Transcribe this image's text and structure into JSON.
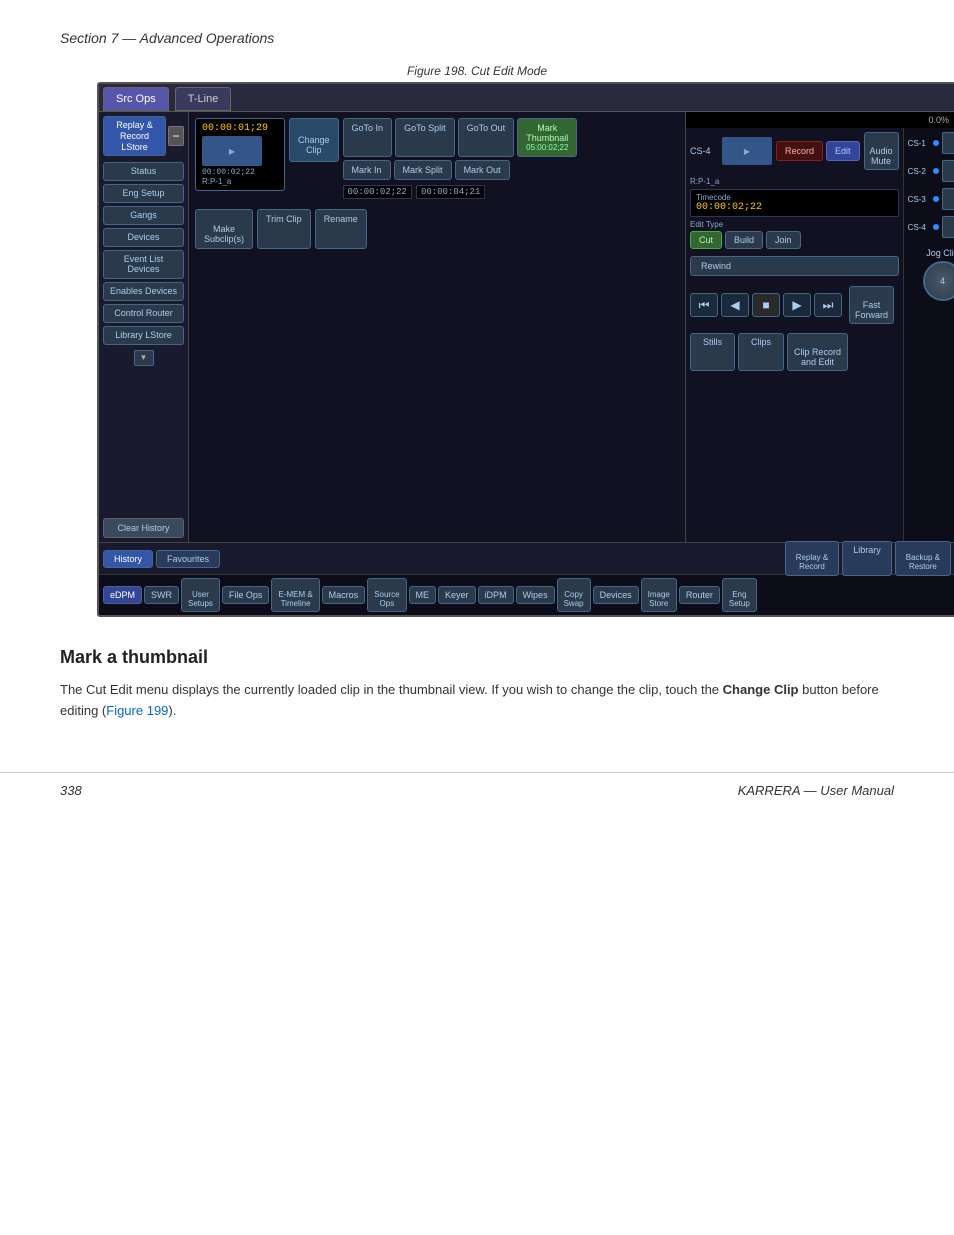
{
  "header": {
    "text": "Section 7 — Advanced Operations"
  },
  "figure": {
    "caption": "Figure 198.  Cut Edit Mode"
  },
  "tabs": {
    "src_ops": "Src Ops",
    "t_line": "T-Line"
  },
  "sidebar": {
    "replay_record": "Replay &\nRecord\nLStore",
    "status": "Status",
    "eng_setup": "Eng Setup",
    "gangs": "Gangs",
    "devices": "Devices",
    "event_list": "Event List\nDevices",
    "enables": "Enables\nDevices",
    "control": "Control\nRouter",
    "library": "Library\nLStore",
    "clear_history": "Clear History",
    "history": "History",
    "favourites": "Favourites"
  },
  "center": {
    "timecode1": "00:00:01;29",
    "timecode2": "00:00:02;22",
    "timecode3": "00:00:04;21",
    "rp1a": "R:P-1_a",
    "change_clip": "Change\nClip",
    "goto_in": "GoTo In",
    "goto_split": "GoTo Split",
    "goto_out": "GoTo Out",
    "mark_thumbnail": "Mark\nThumbnail",
    "mark_thumbnail_tc": "05:00:02;22",
    "mark_in": "Mark In",
    "mark_split": "Mark Split",
    "mark_out": "Mark Out",
    "make_subclip": "Make\nSubclip(s)",
    "trim_clip": "Trim Clip",
    "rename": "Rename"
  },
  "right_panel": {
    "progress": "0.0%",
    "cs4_label": "CS-4",
    "cs1_label": "CS-1",
    "cs2_label": "CS-2",
    "cs3_label": "CS-3",
    "cs4_bottom_label": "CS-4",
    "record": "Record",
    "edit": "Edit",
    "audio_mute": "Audio\nMute",
    "rp1a": "R:P-1_a",
    "timecode_label": "Timecode",
    "timecode_val": "00:00:02;22",
    "edit_type_label": "Edit Type",
    "cut": "Cut",
    "build": "Build",
    "join": "Join",
    "rewind": "Rewind",
    "fast_forward": "Fast\nForward",
    "stills": "Stills",
    "clips": "Clips",
    "clip_record": "Clip Record\nand Edit",
    "jog_clip": "Jog Clip",
    "jog_num": "4"
  },
  "bottom_tabs": {
    "replay_record": "Replay &\nRecord",
    "library": "Library",
    "backup_restore": "Backup &\nRestore"
  },
  "toolbar": {
    "edpm": "eDPM",
    "swr": "SWR",
    "user_setups": "User\nSetups",
    "file_ops": "File Ops",
    "emem_timeline": "E-MEM &\nTimeline",
    "macros": "Macros",
    "source_ops": "Source\nOps",
    "me": "ME",
    "keyer": "Keyer",
    "idpm": "iDPM",
    "wipes": "Wipes",
    "copy_swap": "Copy\nSwap",
    "devices": "Devices",
    "image_store": "Image\nStore",
    "router": "Router",
    "eng_setup": "Eng\nSetup"
  },
  "content": {
    "heading": "Mark a thumbnail",
    "paragraph": "The Cut Edit menu displays the currently loaded clip in the thumbnail view. If you wish to change the clip, touch the Change Clip button before editing (Figure 199).",
    "figure_link": "Figure 199"
  },
  "footer": {
    "left": "338",
    "right": "KARRERA  —  User Manual"
  }
}
